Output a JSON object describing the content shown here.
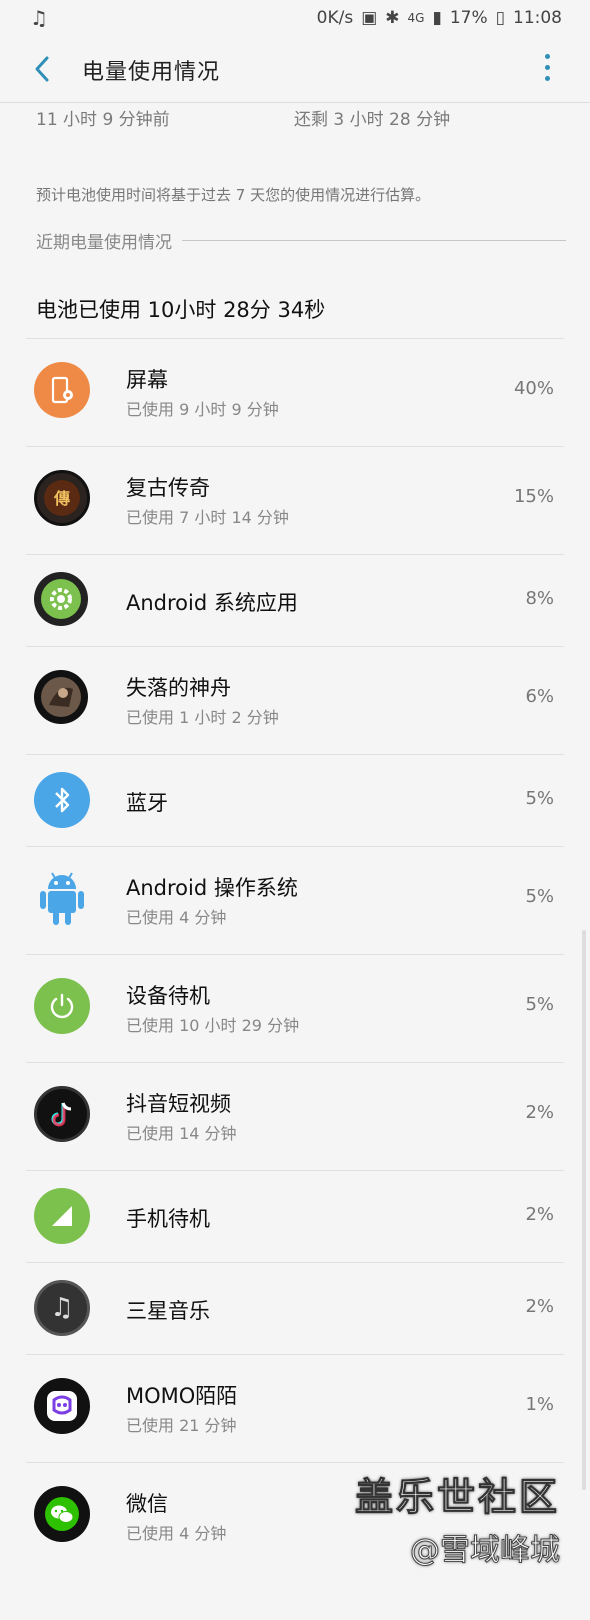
{
  "status": {
    "music_icon": "music-note-icon",
    "speed": "0K/s",
    "network": "4G",
    "battery_pct": "17%",
    "time": "11:08"
  },
  "appbar": {
    "title": "电量使用情况",
    "back_icon": "back-arrow-icon",
    "more_icon": "more-vert-icon"
  },
  "summary": {
    "charged": "11 小时 9 分钟前",
    "remaining": "还剩 3 小时 28 分钟"
  },
  "note": "预计电池使用时间将基于过去 7 天您的使用情况进行估算。",
  "section_title": "近期电量使用情况",
  "total": "电池已使用 10小时 28分 34秒",
  "items": [
    {
      "name": "屏幕",
      "sub": "已使用 9 小时 9 分钟",
      "pct": "40%",
      "icon": "screen-icon",
      "color": "#ee8a45"
    },
    {
      "name": "复古传奇",
      "sub": "已使用 7 小时 14 分钟",
      "pct": "15%",
      "icon": "game-icon",
      "color": "#2a2320"
    },
    {
      "name": "Android 系统应用",
      "sub": "",
      "pct": "8%",
      "icon": "settings-gear-icon",
      "color": "#7cc04d"
    },
    {
      "name": "失落的神舟",
      "sub": "已使用 1 小时 2 分钟",
      "pct": "6%",
      "icon": "game-icon",
      "color": "#5b4a3d"
    },
    {
      "name": "蓝牙",
      "sub": "",
      "pct": "5%",
      "icon": "bluetooth-icon",
      "color": "#4aa6e6"
    },
    {
      "name": "Android 操作系统",
      "sub": "已使用 4 分钟",
      "pct": "5%",
      "icon": "android-icon",
      "color": "#4aa6e6"
    },
    {
      "name": "设备待机",
      "sub": "已使用 10 小时 29 分钟",
      "pct": "5%",
      "icon": "power-icon",
      "color": "#7cc04d"
    },
    {
      "name": "抖音短视频",
      "sub": "已使用 14 分钟",
      "pct": "2%",
      "icon": "douyin-icon",
      "color": "#111"
    },
    {
      "name": "手机待机",
      "sub": "",
      "pct": "2%",
      "icon": "signal-icon",
      "color": "#7cc04d"
    },
    {
      "name": "三星音乐",
      "sub": "",
      "pct": "2%",
      "icon": "music-note-icon",
      "color": "#333"
    },
    {
      "name": "MOMO陌陌",
      "sub": "已使用 21 分钟",
      "pct": "1%",
      "icon": "momo-icon",
      "color": "#111"
    },
    {
      "name": "微信",
      "sub": "已使用 4 分钟",
      "pct": "",
      "icon": "wechat-icon",
      "color": "#111"
    }
  ],
  "watermark": {
    "line1": "盖乐世社区",
    "line2": "@雪域峰城"
  }
}
